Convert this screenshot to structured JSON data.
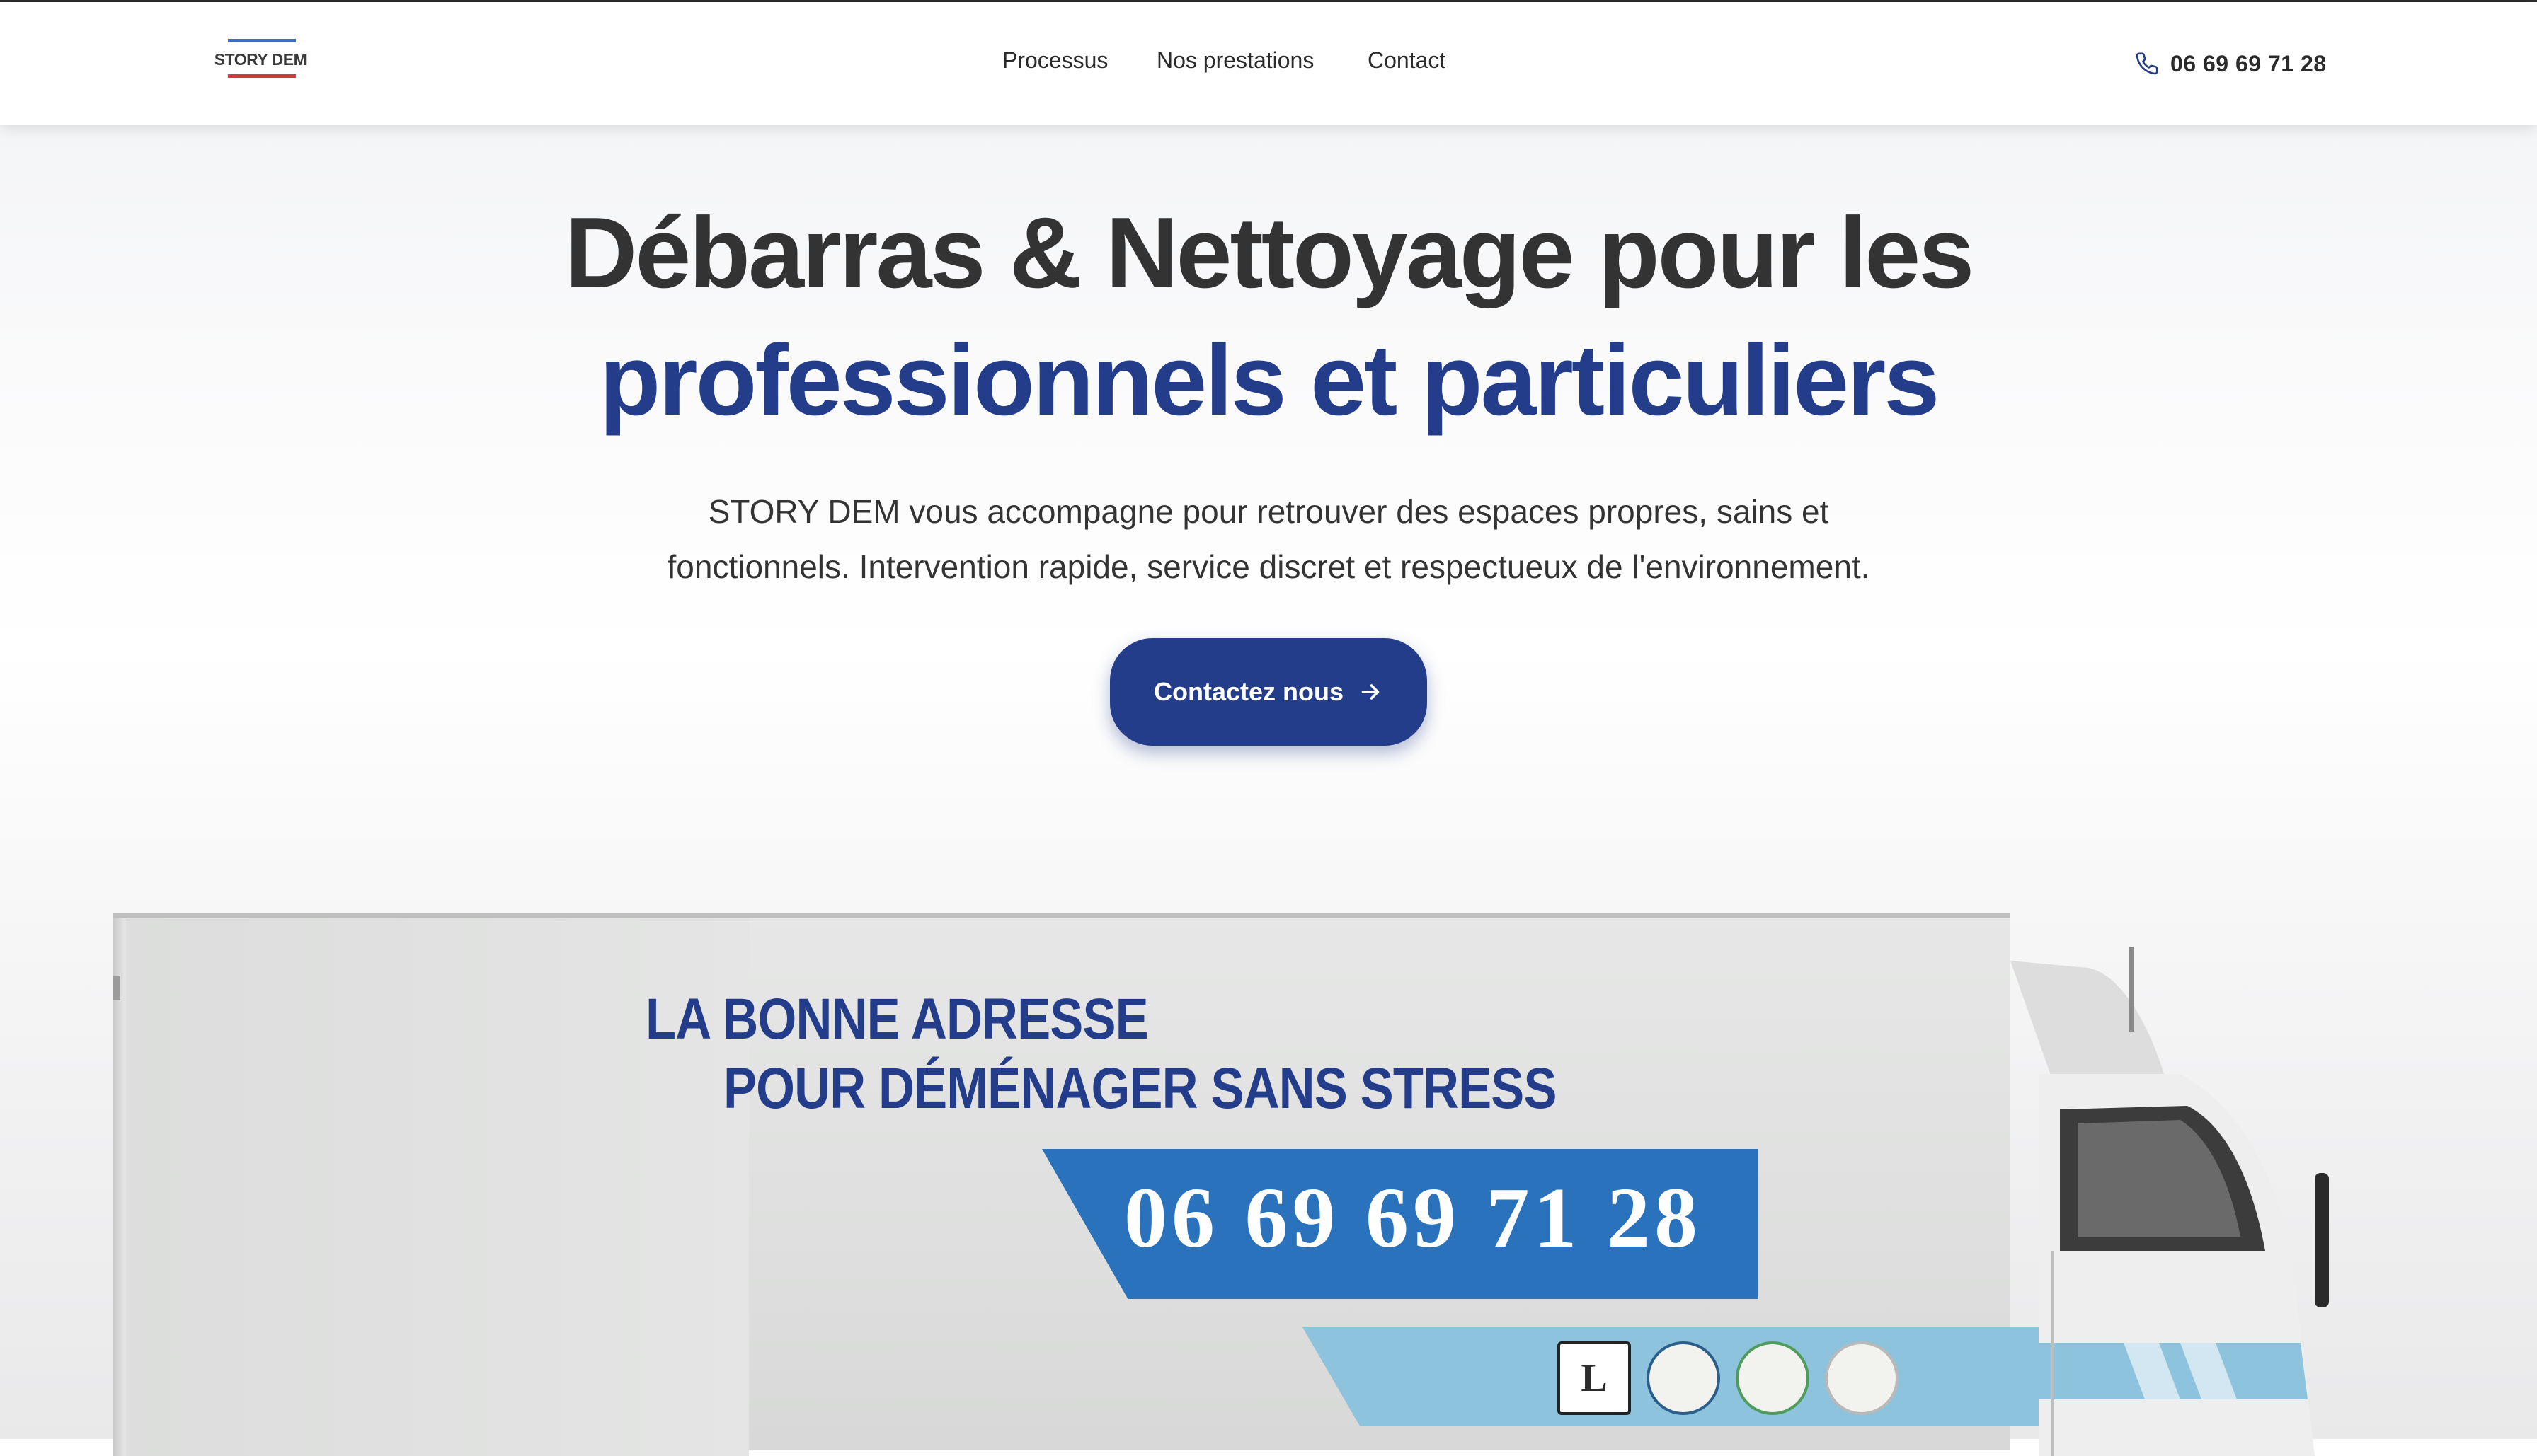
{
  "header": {
    "logo_text": "STORY DEM",
    "nav": [
      {
        "label": "Processus"
      },
      {
        "label": "Nos prestations"
      },
      {
        "label": "Contact"
      }
    ],
    "phone": "06 69 69 71 28"
  },
  "hero": {
    "title_line1": "Débarras & Nettoyage pour les",
    "title_line2": "professionnels et particuliers",
    "subtitle_line1": "STORY DEM vous accompagne pour retrouver des espaces propres, sains et",
    "subtitle_line2": "fonctionnels. Intervention rapide, service discret et respectueux de l'environnement.",
    "cta_label": "Contactez nous"
  },
  "truck": {
    "slogan_line1": "LA BONNE ADRESSE",
    "slogan_line2": "POUR DÉMÉNAGER SANS STRESS",
    "phone": "06 69 69 71 28"
  },
  "colors": {
    "brand_blue": "#233d8a",
    "text_dark": "#333333",
    "truck_banner_blue": "#2a72bb",
    "truck_stripe": "#8ec3dd",
    "logo_top_bar": "#3a6fc4",
    "logo_bottom_bar": "#d8373f"
  },
  "icons": {
    "phone": "phone-icon",
    "cta_arrow": "arrow-right-icon"
  }
}
